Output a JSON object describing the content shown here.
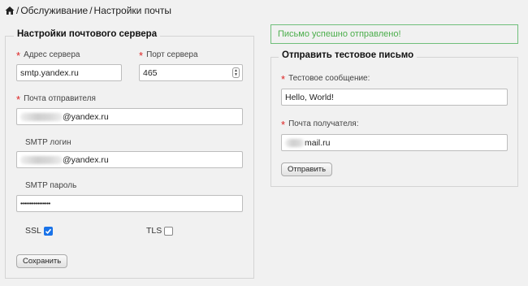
{
  "breadcrumb": {
    "icon": "home-icon",
    "separator1": "/",
    "item1": "Обслуживание",
    "separator2": "/",
    "item2": "Настройки почты"
  },
  "server_settings": {
    "legend": "Настройки почтового сервера",
    "host_label": "Адрес сервера",
    "host_value": "smtp.yandex.ru",
    "port_label": "Порт сервера",
    "port_value": "465",
    "sender_label": "Почта отправителя",
    "sender_value_suffix": "@yandex.ru",
    "login_label": "SMTP логин",
    "login_value_suffix": "@yandex.ru",
    "password_label": "SMTP пароль",
    "password_value": "••••••••••••••••",
    "ssl_label": "SSL",
    "ssl_checked": true,
    "tls_label": "TLS",
    "tls_checked": false,
    "save_button": "Сохранить"
  },
  "alert": {
    "message": "Письмо успешно отправлено!",
    "color": "#4cae4c"
  },
  "test_mail": {
    "legend": "Отправить тестовое письмо",
    "message_label": "Тестовое сообщение:",
    "message_value": "Hello, World!",
    "recipient_label": "Почта получателя:",
    "recipient_value_suffix": "mail.ru",
    "send_button": "Отправить"
  },
  "colors": {
    "required": "#dd2222",
    "accent": "#1a73e8",
    "success": "#4cae4c"
  }
}
